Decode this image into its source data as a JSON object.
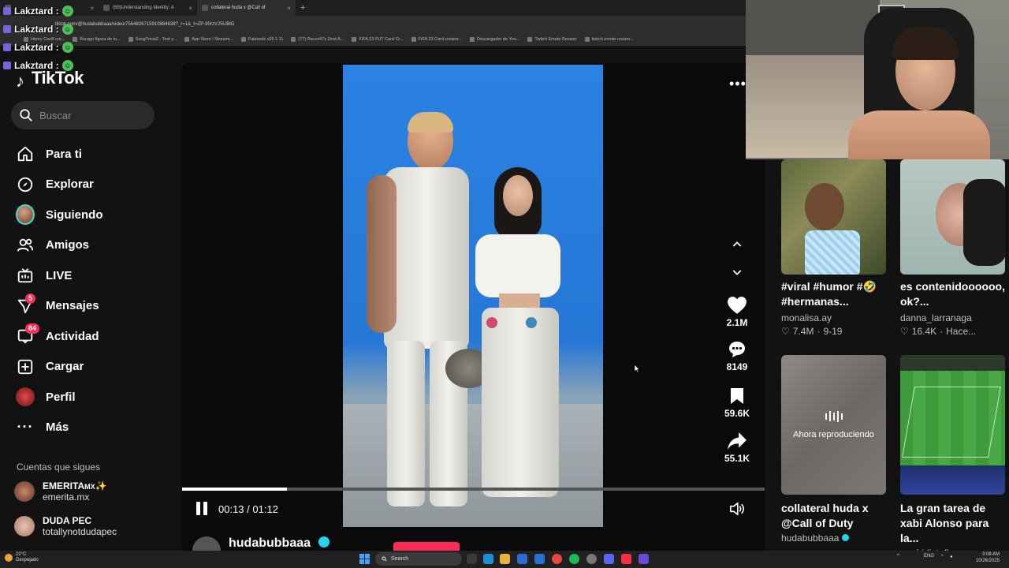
{
  "browser": {
    "tabs": [
      {
        "label": ""
      },
      {
        "label": "(69)Understanding Identity: A"
      },
      {
        "label": "collateral huda x @Call of "
      }
    ],
    "url": "tiktok.com/@hudabubbaaa/video/7564826715910884638?_r=1&_t=ZP-90rzVJSUBlG",
    "bookmarks": [
      "Henry Cavill cre...",
      "Burago figura de tu...",
      "SongTrivia2 - Test y...",
      "App Store / Streami...",
      "Faletools v25.1.11",
      "(77) Racco97s Zest-A...",
      "FIFA 23 FUT Card Cr...",
      "FIFA 23 Card creator...",
      "Descargador de You...",
      "Twitch Emote Resizer",
      "twitch emote resizer..."
    ]
  },
  "chat": {
    "lines": [
      {
        "user": "Lakztard :"
      },
      {
        "user": "Lakztard :"
      },
      {
        "user": "Lakztard :"
      },
      {
        "user": "Lakztard :"
      },
      {
        "user": "Lakztard :"
      }
    ]
  },
  "sidebar": {
    "logo": "TikTok",
    "search_placeholder": "Buscar",
    "items": [
      {
        "label": "Para ti",
        "icon": "home-icon"
      },
      {
        "label": "Explorar",
        "icon": "compass-icon"
      },
      {
        "label": "Siguiendo",
        "icon": "avatar"
      },
      {
        "label": "Amigos",
        "icon": "friends-icon"
      },
      {
        "label": "LIVE",
        "icon": "live-icon"
      },
      {
        "label": "Mensajes",
        "icon": "messages-icon",
        "badge": "5"
      },
      {
        "label": "Actividad",
        "icon": "activity-icon",
        "badge": "84"
      },
      {
        "label": "Cargar",
        "icon": "upload-icon"
      },
      {
        "label": "Perfil",
        "icon": "profile-avatar"
      },
      {
        "label": "Más",
        "icon": "more-icon"
      }
    ],
    "following_title": "Cuentas que sigues",
    "following": [
      {
        "name": "EMERITA",
        "suffix": "MX",
        "emoji": "✨",
        "handle": "emerita.mx"
      },
      {
        "name": "DUDA PEC",
        "handle": "totallynotdudapec"
      }
    ]
  },
  "video": {
    "likes": "2.1M",
    "comments": "8149",
    "saves": "59.6K",
    "shares": "55.1K",
    "time_current": "00:13",
    "time_total": "01:12",
    "time_separator": " / ",
    "progress": 0.18,
    "author": "hudabubbaaa"
  },
  "recommendations": [
    {
      "title": "#viral #humor #🤣 #hermanas...",
      "author": "monalisa.ay",
      "likes": "7.4M",
      "date": "9-19"
    },
    {
      "title": "es contenidoooooo, ok?...",
      "author": "danna_larranaga",
      "likes": "16.4K",
      "date": "Hace..."
    },
    {
      "title": "collateral huda x @Call of Duty",
      "author": "hudabubbaaa",
      "now_playing": "Ahora reproduciendo",
      "verified": true
    },
    {
      "title": "La gran tarea de xabi Alonso para la...",
      "author": "madridistaflow"
    }
  ],
  "taskbar": {
    "temperature": "22°C",
    "weather": "Despejado",
    "search": "Search",
    "lang": "ENG",
    "time": "3:08 AM",
    "date": "10/26/2025"
  },
  "colors": {
    "accent": "#fe2c55",
    "background": "#121212",
    "video_bg": "#2b82e3"
  }
}
